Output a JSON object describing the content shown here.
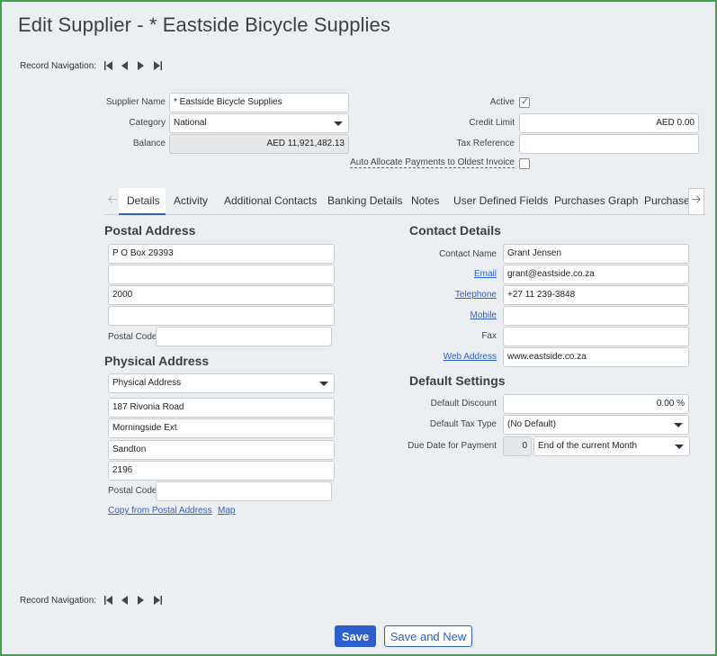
{
  "title": "Edit Supplier - * Eastside Bicycle Supplies",
  "record_nav": {
    "label": "Record Navigation:"
  },
  "header": {
    "supplier_name_label": "Supplier Name",
    "supplier_name_value": "* Eastside Bicycle Supplies",
    "category_label": "Category",
    "category_value": "National",
    "balance_label": "Balance",
    "balance_value": "AED 11,921,482.13",
    "active_label": "Active",
    "active_checked": true,
    "credit_limit_label": "Credit Limit",
    "credit_limit_value": "AED 0.00",
    "tax_reference_label": "Tax Reference",
    "tax_reference_value": "",
    "auto_allocate_label": "Auto Allocate Payments to Oldest Invoice",
    "auto_allocate_checked": false
  },
  "tabs": [
    "Details",
    "Activity",
    "Additional Contacts",
    "Banking Details",
    "Notes",
    "User Defined Fields",
    "Purchases Graph",
    "Purchase O"
  ],
  "postal": {
    "heading": "Postal Address",
    "lines": [
      "P O Box 29393",
      "",
      "2000",
      ""
    ],
    "postal_code_label": "Postal Code",
    "postal_code_value": ""
  },
  "physical": {
    "heading": "Physical Address",
    "type_value": "Physical Address",
    "lines": [
      "187 Rivonia Road",
      "Morningside Ext",
      "Sandton",
      "2196"
    ],
    "postal_code_label": "Postal Code",
    "postal_code_value": "",
    "copy_link": "Copy from Postal Address",
    "map_link": "Map"
  },
  "contact": {
    "heading": "Contact Details",
    "contact_name_label": "Contact Name",
    "contact_name_value": "Grant Jensen",
    "email_label": "Email",
    "email_value": "grant@eastside.co.za",
    "telephone_label": "Telephone",
    "telephone_value": "+27 11 239-3848",
    "mobile_label": "Mobile",
    "mobile_value": "",
    "fax_label": "Fax",
    "fax_value": "",
    "web_label": "Web Address",
    "web_value": "www.eastside.co.za"
  },
  "defaults": {
    "heading": "Default Settings",
    "discount_label": "Default Discount",
    "discount_value": "0.00 %",
    "tax_type_label": "Default Tax Type",
    "tax_type_value": "(No Default)",
    "due_date_label": "Due Date for Payment",
    "due_date_days": "0",
    "due_date_option": "End of the current Month"
  },
  "buttons": {
    "save": "Save",
    "save_and_new": "Save and New"
  },
  "colors": {
    "accent": "#2c5fcc",
    "frame": "#3fa34d"
  }
}
